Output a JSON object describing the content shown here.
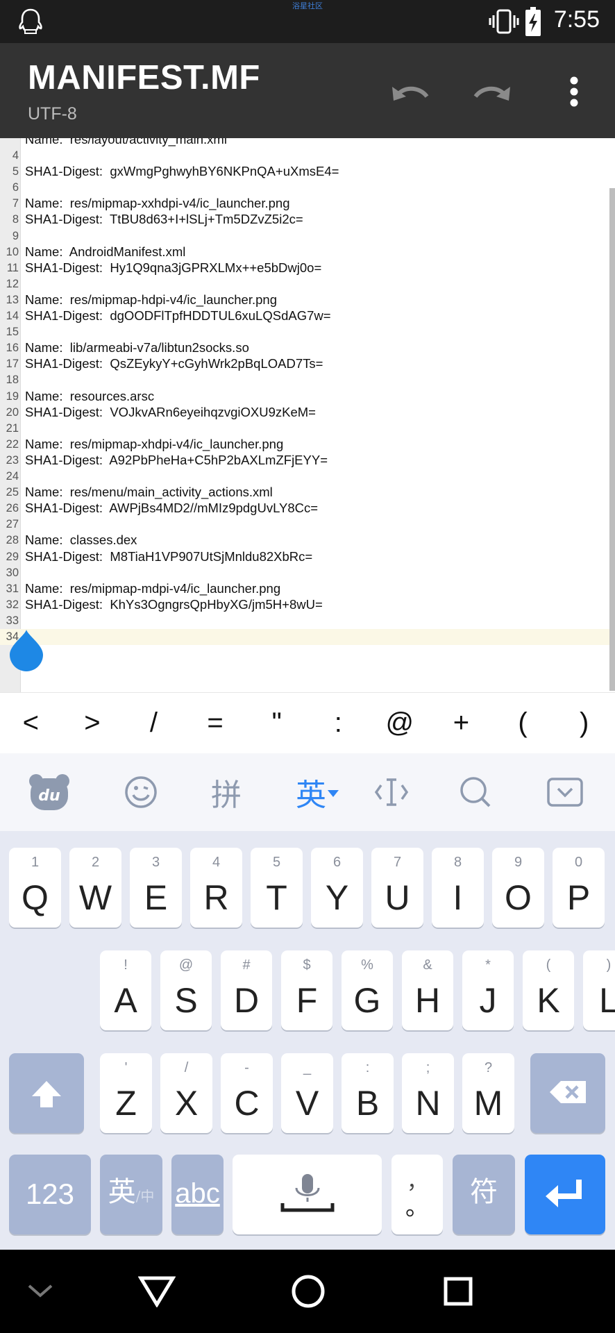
{
  "status_bar": {
    "center_text": "浴星社区",
    "time": "7:55"
  },
  "app_bar": {
    "title": "MANIFEST.MF",
    "subtitle": "UTF-8"
  },
  "editor": {
    "partial_top_line": "Name:  res/layout/activity_main.xml",
    "lines": [
      {
        "n": "4",
        "text": ""
      },
      {
        "n": "5",
        "text": "SHA1-Digest:  gxWmgPghwyhBY6NKPnQA+uXmsE4="
      },
      {
        "n": "6",
        "text": ""
      },
      {
        "n": "7",
        "text": "Name:  res/mipmap-xxhdpi-v4/ic_launcher.png"
      },
      {
        "n": "8",
        "text": "SHA1-Digest:  TtBU8d63+I+lSLj+Tm5DZvZ5i2c="
      },
      {
        "n": "9",
        "text": ""
      },
      {
        "n": "10",
        "text": "Name:  AndroidManifest.xml"
      },
      {
        "n": "11",
        "text": "SHA1-Digest:  Hy1Q9qna3jGPRXLMx++e5bDwj0o="
      },
      {
        "n": "12",
        "text": ""
      },
      {
        "n": "13",
        "text": "Name:  res/mipmap-hdpi-v4/ic_launcher.png"
      },
      {
        "n": "14",
        "text": "SHA1-Digest:  dgOODFlTpfHDDTUL6xuLQSdAG7w="
      },
      {
        "n": "15",
        "text": ""
      },
      {
        "n": "16",
        "text": "Name:  lib/armeabi-v7a/libtun2socks.so"
      },
      {
        "n": "17",
        "text": "SHA1-Digest:  QsZEykyY+cGyhWrk2pBqLOAD7Ts="
      },
      {
        "n": "18",
        "text": ""
      },
      {
        "n": "19",
        "text": "Name:  resources.arsc"
      },
      {
        "n": "20",
        "text": "SHA1-Digest:  VOJkvARn6eyeihqzvgiOXU9zKeM="
      },
      {
        "n": "21",
        "text": ""
      },
      {
        "n": "22",
        "text": "Name:  res/mipmap-xhdpi-v4/ic_launcher.png"
      },
      {
        "n": "23",
        "text": "SHA1-Digest:  A92PbPheHa+C5hP2bAXLmZFjEYY="
      },
      {
        "n": "24",
        "text": ""
      },
      {
        "n": "25",
        "text": "Name:  res/menu/main_activity_actions.xml"
      },
      {
        "n": "26",
        "text": "SHA1-Digest:  AWPjBs4MD2//mMIz9pdgUvLY8Cc="
      },
      {
        "n": "27",
        "text": ""
      },
      {
        "n": "28",
        "text": "Name:  classes.dex"
      },
      {
        "n": "29",
        "text": "SHA1-Digest:  M8TiaH1VP907UtSjMnldu82XbRc="
      },
      {
        "n": "30",
        "text": ""
      },
      {
        "n": "31",
        "text": "Name:  res/mipmap-mdpi-v4/ic_launcher.png"
      },
      {
        "n": "32",
        "text": "SHA1-Digest:  KhYs3OgngrsQpHbyXG/jm5H+8wU="
      },
      {
        "n": "33",
        "text": ""
      },
      {
        "n": "34",
        "text": ""
      }
    ],
    "current_line": "34"
  },
  "symbols": [
    "<",
    ">",
    "/",
    "=",
    "\"",
    ":",
    "@",
    "+",
    "(",
    ")"
  ],
  "ime_toolbar": {
    "logo": "du",
    "pinyin": "拼",
    "english": "英"
  },
  "keyboard": {
    "row1": [
      {
        "k": "Q",
        "s": "1"
      },
      {
        "k": "W",
        "s": "2"
      },
      {
        "k": "E",
        "s": "3"
      },
      {
        "k": "R",
        "s": "4"
      },
      {
        "k": "T",
        "s": "5"
      },
      {
        "k": "Y",
        "s": "6"
      },
      {
        "k": "U",
        "s": "7"
      },
      {
        "k": "I",
        "s": "8"
      },
      {
        "k": "O",
        "s": "9"
      },
      {
        "k": "P",
        "s": "0"
      }
    ],
    "row2": [
      {
        "k": "A",
        "s": "!"
      },
      {
        "k": "S",
        "s": "@"
      },
      {
        "k": "D",
        "s": "#"
      },
      {
        "k": "F",
        "s": "$"
      },
      {
        "k": "G",
        "s": "%"
      },
      {
        "k": "H",
        "s": "&"
      },
      {
        "k": "J",
        "s": "*"
      },
      {
        "k": "K",
        "s": "("
      },
      {
        "k": "L",
        "s": ")"
      }
    ],
    "row3": [
      {
        "k": "Z",
        "s": "'"
      },
      {
        "k": "X",
        "s": "/"
      },
      {
        "k": "C",
        "s": "-"
      },
      {
        "k": "V",
        "s": "_"
      },
      {
        "k": "B",
        "s": ":"
      },
      {
        "k": "N",
        "s": ";"
      },
      {
        "k": "M",
        "s": "?"
      }
    ],
    "num_label": "123",
    "lang_main": "英",
    "lang_sub": "/中",
    "abc_label": "abc",
    "punct_main": "，",
    "punct_sub": "。",
    "symbol_label": "符"
  }
}
